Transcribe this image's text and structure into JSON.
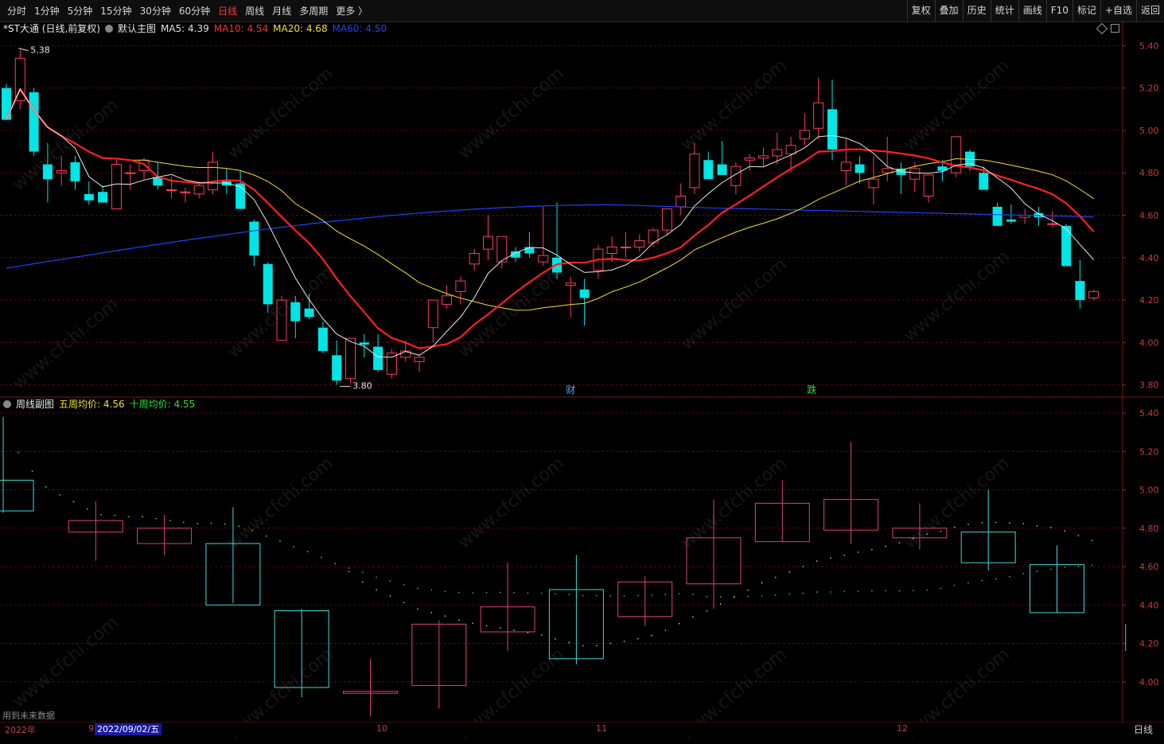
{
  "toolbar": {
    "left_tabs": [
      "分时",
      "1分钟",
      "5分钟",
      "15分钟",
      "30分钟",
      "60分钟",
      "日线",
      "周线",
      "月线",
      "多周期",
      "更多 〉"
    ],
    "active_tab": "日线",
    "right_buttons": [
      "复权",
      "叠加",
      "历史",
      "统计",
      "画线",
      "F10",
      "标记",
      "+自选",
      "返回"
    ]
  },
  "main_chart": {
    "stock": "*ST大通 (日线,前复权)",
    "indicator": "默认主图",
    "ma": [
      {
        "label": "MA5: 4.39",
        "color": "#e0e0e0"
      },
      {
        "label": "MA10: 4.54",
        "color": "#ff2a2a"
      },
      {
        "label": "MA20: 4.68",
        "color": "#f0e030"
      },
      {
        "label": "MA60: 4.50",
        "color": "#2040ff"
      }
    ],
    "high_label": "5.38",
    "low_label": "3.80",
    "y_ticks": [
      "5.40",
      "5.20",
      "5.00",
      "4.80",
      "4.60",
      "4.40",
      "4.20",
      "4.00",
      "3.80"
    ],
    "markers": [
      {
        "text": "财",
        "color": "#4aa8ff"
      },
      {
        "text": "跌",
        "color": "#30e030"
      }
    ]
  },
  "sub_chart": {
    "indicator": "周线副图",
    "five_week": "五周均价: 4.56",
    "ten_week": "十周均价: 4.55",
    "five_color": "#f0e030",
    "ten_color": "#30e030",
    "y_ticks": [
      "5.40",
      "5.20",
      "5.00",
      "4.80",
      "4.60",
      "4.40",
      "4.20",
      "4.00"
    ]
  },
  "bottom": {
    "year": "2022年",
    "month_9": "9",
    "selected_date": "2022/09/02/五",
    "month_10": "10",
    "month_11": "11",
    "month_12": "12",
    "period": "日线",
    "note": "用到未来数据"
  },
  "watermark": "www.cfchi.com",
  "chart_data": [
    {
      "type": "candlestick",
      "title": "*ST大通 (日线,前复权)",
      "ylim": [
        3.75,
        5.45
      ],
      "ohlc": [
        [
          5.2,
          5.22,
          5.05,
          5.05
        ],
        [
          5.14,
          5.38,
          5.1,
          5.34
        ],
        [
          5.18,
          5.2,
          4.88,
          4.9
        ],
        [
          4.84,
          4.94,
          4.66,
          4.77
        ],
        [
          4.8,
          4.88,
          4.74,
          4.81
        ],
        [
          4.85,
          4.88,
          4.72,
          4.76
        ],
        [
          4.7,
          4.76,
          4.65,
          4.67
        ],
        [
          4.71,
          4.74,
          4.66,
          4.66
        ],
        [
          4.63,
          4.86,
          4.63,
          4.84
        ],
        [
          4.8,
          4.84,
          4.72,
          4.8
        ],
        [
          4.81,
          4.87,
          4.77,
          4.86
        ],
        [
          4.78,
          4.85,
          4.72,
          4.74
        ],
        [
          4.72,
          4.78,
          4.68,
          4.72
        ],
        [
          4.71,
          4.73,
          4.66,
          4.71
        ],
        [
          4.7,
          4.76,
          4.68,
          4.74
        ],
        [
          4.72,
          4.9,
          4.7,
          4.85
        ],
        [
          4.76,
          4.82,
          4.7,
          4.74
        ],
        [
          4.75,
          4.81,
          4.64,
          4.63
        ],
        [
          4.57,
          4.58,
          4.36,
          4.41
        ],
        [
          4.37,
          4.38,
          4.14,
          4.18
        ],
        [
          4.01,
          4.22,
          4.01,
          4.2
        ],
        [
          4.19,
          4.22,
          4.02,
          4.1
        ],
        [
          4.16,
          4.23,
          4.11,
          4.12
        ],
        [
          4.07,
          4.1,
          3.95,
          3.96
        ],
        [
          3.94,
          4.01,
          3.8,
          3.82
        ],
        [
          3.83,
          4.02,
          3.81,
          4.02
        ],
        [
          4.0,
          4.04,
          3.93,
          3.99
        ],
        [
          3.98,
          4.04,
          3.86,
          3.87
        ],
        [
          3.85,
          3.97,
          3.83,
          3.95
        ],
        [
          3.93,
          4.01,
          3.91,
          3.96
        ],
        [
          3.91,
          3.94,
          3.86,
          3.93
        ],
        [
          4.07,
          4.12,
          4.0,
          4.2
        ],
        [
          4.18,
          4.27,
          4.16,
          4.22
        ],
        [
          4.24,
          4.31,
          4.18,
          4.29
        ],
        [
          4.37,
          4.44,
          4.34,
          4.42
        ],
        [
          4.44,
          4.6,
          4.39,
          4.5
        ],
        [
          4.38,
          4.46,
          4.35,
          4.5
        ],
        [
          4.43,
          4.45,
          4.38,
          4.4
        ],
        [
          4.45,
          4.52,
          4.4,
          4.42
        ],
        [
          4.38,
          4.64,
          4.36,
          4.41
        ],
        [
          4.4,
          4.66,
          4.3,
          4.33
        ],
        [
          4.27,
          4.31,
          4.12,
          4.28
        ],
        [
          4.25,
          4.3,
          4.08,
          4.21
        ],
        [
          4.34,
          4.46,
          4.3,
          4.44
        ],
        [
          4.42,
          4.5,
          4.38,
          4.45
        ],
        [
          4.45,
          4.52,
          4.4,
          4.45
        ],
        [
          4.45,
          4.51,
          4.43,
          4.48
        ],
        [
          4.47,
          4.54,
          4.45,
          4.53
        ],
        [
          4.53,
          4.63,
          4.51,
          4.63
        ],
        [
          4.64,
          4.75,
          4.6,
          4.69
        ],
        [
          4.73,
          4.94,
          4.7,
          4.89
        ],
        [
          4.86,
          4.9,
          4.78,
          4.77
        ],
        [
          4.84,
          4.95,
          4.79,
          4.79
        ],
        [
          4.74,
          4.85,
          4.7,
          4.83
        ],
        [
          4.86,
          4.89,
          4.81,
          4.87
        ],
        [
          4.87,
          4.92,
          4.83,
          4.88
        ],
        [
          4.88,
          4.99,
          4.84,
          4.91
        ],
        [
          4.89,
          4.97,
          4.8,
          4.93
        ],
        [
          4.96,
          5.08,
          4.93,
          5.0
        ],
        [
          5.01,
          5.25,
          4.96,
          5.13
        ],
        [
          5.1,
          5.24,
          4.86,
          4.91
        ],
        [
          4.81,
          4.96,
          4.74,
          4.85
        ],
        [
          4.84,
          4.88,
          4.75,
          4.8
        ],
        [
          4.73,
          4.88,
          4.65,
          4.77
        ],
        [
          4.8,
          4.97,
          4.76,
          4.82
        ],
        [
          4.82,
          4.85,
          4.7,
          4.79
        ],
        [
          4.77,
          4.85,
          4.71,
          4.82
        ],
        [
          4.69,
          4.79,
          4.66,
          4.79
        ],
        [
          4.83,
          4.86,
          4.76,
          4.81
        ],
        [
          4.8,
          4.97,
          4.78,
          4.97
        ],
        [
          4.9,
          4.91,
          4.81,
          4.83
        ],
        [
          4.8,
          4.83,
          4.72,
          4.72
        ],
        [
          4.64,
          4.66,
          4.55,
          4.55
        ],
        [
          4.58,
          4.65,
          4.56,
          4.57
        ],
        [
          4.59,
          4.63,
          4.56,
          4.6
        ],
        [
          4.61,
          4.64,
          4.55,
          4.59
        ],
        [
          4.56,
          4.62,
          4.54,
          4.56
        ],
        [
          4.55,
          4.56,
          4.37,
          4.36
        ],
        [
          4.29,
          4.39,
          4.16,
          4.2
        ],
        [
          4.21,
          4.25,
          4.2,
          4.24
        ]
      ]
    },
    {
      "type": "candlestick",
      "title": "周线副图",
      "ylim": [
        3.8,
        5.45
      ],
      "ohlc": [
        [
          5.05,
          5.38,
          4.88,
          4.89
        ],
        [
          4.78,
          4.94,
          4.63,
          4.84
        ],
        [
          4.72,
          4.87,
          4.66,
          4.8
        ],
        [
          4.72,
          4.91,
          4.41,
          4.4
        ],
        [
          4.37,
          4.38,
          3.92,
          3.97
        ],
        [
          3.94,
          4.12,
          3.82,
          3.95
        ],
        [
          3.98,
          4.32,
          3.86,
          4.3
        ],
        [
          4.26,
          4.62,
          4.16,
          4.39
        ],
        [
          4.48,
          4.66,
          4.09,
          4.12
        ],
        [
          4.34,
          4.55,
          4.29,
          4.52
        ],
        [
          4.51,
          4.95,
          4.38,
          4.75
        ],
        [
          4.73,
          5.05,
          4.73,
          4.93
        ],
        [
          4.79,
          5.25,
          4.72,
          4.95
        ],
        [
          4.75,
          4.93,
          4.69,
          4.8
        ],
        [
          4.78,
          5.0,
          4.58,
          4.62
        ],
        [
          4.61,
          4.71,
          4.36,
          4.36
        ],
        [
          4.38,
          4.3,
          4.16,
          4.31
        ]
      ]
    }
  ]
}
